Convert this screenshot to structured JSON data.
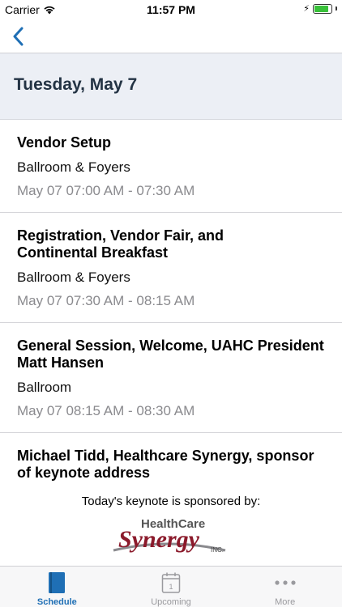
{
  "status_bar": {
    "carrier": "Carrier",
    "time": "11:57 PM",
    "battery_level": 0.85,
    "battery_color": "#39c13a"
  },
  "nav": {
    "back_icon": "chevron-left-icon",
    "accent_color": "#1f6fb5"
  },
  "date_header": {
    "title": "Tuesday, May 7"
  },
  "sessions": [
    {
      "title": "Vendor Setup",
      "location": "Ballroom & Foyers",
      "time": "May 07 07:00 AM - 07:30 AM"
    },
    {
      "title": "Registration, Vendor Fair, and Continental Breakfast",
      "location": "Ballroom & Foyers",
      "time": "May 07 07:30 AM - 08:15 AM"
    },
    {
      "title": "General Session, Welcome,  UAHC President Matt Hansen",
      "location": "Ballroom",
      "time": "May 07 08:15 AM - 08:30 AM"
    },
    {
      "title": "Michael Tidd, Healthcare Synergy, sponsor of keynote address",
      "location": "",
      "time": ""
    }
  ],
  "sponsor": {
    "text": "Today's keynote is sponsored by:",
    "logo_line1": "HealthCare",
    "logo_line2": "Synergy",
    "logo_suffix": "INC."
  },
  "tab_bar": {
    "tabs": [
      {
        "label": "Schedule",
        "icon": "book-icon",
        "active": true
      },
      {
        "label": "Upcoming",
        "icon": "calendar-icon",
        "active": false
      },
      {
        "label": "More",
        "icon": "more-dots-icon",
        "active": false
      }
    ],
    "calendar_day": "1"
  }
}
